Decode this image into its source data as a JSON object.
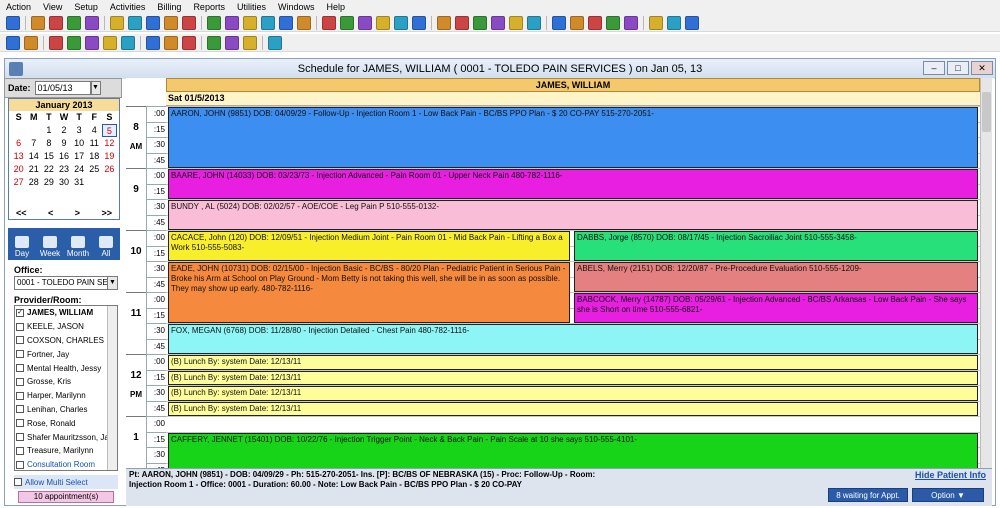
{
  "menu": [
    "Action",
    "View",
    "Setup",
    "Activities",
    "Billing",
    "Reports",
    "Utilities",
    "Windows",
    "Help"
  ],
  "window": {
    "title": "Schedule for JAMES, WILLIAM ( 0001 - TOLEDO PAIN SERVICES ) on Jan 05, 13"
  },
  "date": {
    "label": "Date:",
    "value": "01/05/13"
  },
  "calendar": {
    "month": "January 2013",
    "dayheaders": [
      "S",
      "M",
      "T",
      "W",
      "T",
      "F",
      "S"
    ],
    "weeks": [
      [
        "",
        "",
        "1",
        "2",
        "3",
        "4",
        "5"
      ],
      [
        "6",
        "7",
        "8",
        "9",
        "10",
        "11",
        "12"
      ],
      [
        "13",
        "14",
        "15",
        "16",
        "17",
        "18",
        "19"
      ],
      [
        "20",
        "21",
        "22",
        "23",
        "24",
        "25",
        "26"
      ],
      [
        "27",
        "28",
        "29",
        "30",
        "31",
        "",
        ""
      ]
    ],
    "nav": [
      "<<",
      "<",
      ">",
      ">>"
    ]
  },
  "viewtabs": [
    "Day",
    "Week",
    "Month",
    "All"
  ],
  "office": {
    "label": "Office:",
    "value": "0001 - TOLEDO PAIN SE"
  },
  "providers": {
    "label": "Provider/Room:",
    "items": [
      {
        "name": "JAMES, WILLIAM",
        "checked": true
      },
      {
        "name": "KEELE, JASON",
        "checked": false
      },
      {
        "name": "COXSON, CHARLES",
        "checked": false
      },
      {
        "name": "Fortner, Jay",
        "checked": false
      },
      {
        "name": "Mental Health, Jessy",
        "checked": false
      },
      {
        "name": "Grosse, Kris",
        "checked": false
      },
      {
        "name": "Harper, Marilynn",
        "checked": false
      },
      {
        "name": "Lenihan, Charles",
        "checked": false
      },
      {
        "name": "Rose, Ronald",
        "checked": false
      },
      {
        "name": "Shafer Mauritzsson, Ja",
        "checked": false
      },
      {
        "name": "Treasure, Marilynn",
        "checked": false
      },
      {
        "name": "Consultation Room",
        "checked": false
      }
    ]
  },
  "multiselect": "Allow Multi Select",
  "appointment_count": "10 appointment(s)",
  "schedule": {
    "provider": "JAMES, WILLIAM",
    "date": "Sat 01/5/2013",
    "hours": [
      {
        "h": "8",
        "ampm": "AM"
      },
      {
        "h": "9",
        "ampm": ""
      },
      {
        "h": "10",
        "ampm": ""
      },
      {
        "h": "11",
        "ampm": ""
      },
      {
        "h": "12",
        "ampm": "PM"
      },
      {
        "h": "1",
        "ampm": ""
      }
    ],
    "quarters": [
      ":00",
      ":15",
      ":30",
      ":45"
    ],
    "appointments": [
      {
        "text": "AARON, JOHN  (9851)  DOB: 04/09/29 -  Follow-Up - Injection Room 1 - Low Back Pain - BC/BS PPO Plan - $ 20 CO-PAY       515-270-2051-",
        "color": "#3c8ef0"
      },
      {
        "text": "BAARE, JOHN  (14033)  DOB: 03/23/73 -  Injection Advanced  - Pain Room 01 - Upper Neck Pain       480-782-1116-",
        "color": "#e81ee0"
      },
      {
        "text": "BUNDY , AL  (5024)  DOB: 02/02/57 -  AOE/COE - Leg Pain    P 510-555-0132-",
        "color": "#f9bdd8"
      },
      {
        "text": "CACACE, John  (120)  DOB: 12/09/51 -  Injection Medium Joint  - Pain Room 01 - Mid Back Pain - Lifting a Box a Work      510-555-5083-",
        "color": "#f8ee2a"
      },
      {
        "text": "DABBS, Jorge  (8570)  DOB: 08/17/45 -  Injection Sacroiliac Joint      510-555-3458-",
        "color": "#28e07a"
      },
      {
        "text": "EADE, JOHN  (10731)  DOB: 02/15/00 -  Injection Basic  - BC/BS - 80/20 Plan - Pediatric Patient in Serious Pain - Broke his Arm at School on Play Ground - Mom Betty is not taking this well, she will be in as soon as possible. They may show up early.      480-782-1116-",
        "color": "#f58a3e"
      },
      {
        "text": "ABELS, Merry  (2151)  DOB: 12/20/87 -  Pre-Procedure Evaluation       510-555-1209-",
        "color": "#e58080"
      },
      {
        "text": "BABCOCK, Merry  (14787)  DOB: 05/29/61 -  Injection Advanced  - BC/BS Arkansas - Low Back Pain - She says she is Short on time      510-555-6821-",
        "color": "#e81ee0"
      },
      {
        "text": "FOX, MEGAN  (6768)  DOB: 11/28/80 -  Injection Detailed  - Chest Pain      480-782-1116-",
        "color": "#8df5f5"
      },
      {
        "text": "(B) Lunch  By: system  Date: 12/13/11",
        "color": "#fdfd9a"
      },
      {
        "text": "(B) Lunch  By: system  Date: 12/13/11",
        "color": "#fdfd9a"
      },
      {
        "text": "(B) Lunch  By: system  Date: 12/13/11",
        "color": "#fdfd9a"
      },
      {
        "text": "(B) Lunch  By: system  Date: 12/13/11",
        "color": "#fdfd9a"
      },
      {
        "text": "CAFFERY, JENNET  (15401)  DOB: 10/22/76 -  Injection Trigger Point  - Neck & Back Pain - Pain Scale at 10 she says      510-555-4101-",
        "color": "#18d418"
      }
    ]
  },
  "status": {
    "line1": "Pt: AARON, JOHN  (9851) - DOB: 04/09/29 - Ph: 515-270-2051- Ins. [P]: BC/BS OF NEBRASKA (15) - Proc: Follow-Up - Room:",
    "line2": "Injection Room 1  - Office: 0001  - Duration: 60.00 - Note:  Low Back Pain - BC/BS PPO Plan - $ 20 CO-PAY",
    "hide": "Hide Patient Info",
    "waiting": "8 waiting for Appt.",
    "option": "Option"
  }
}
